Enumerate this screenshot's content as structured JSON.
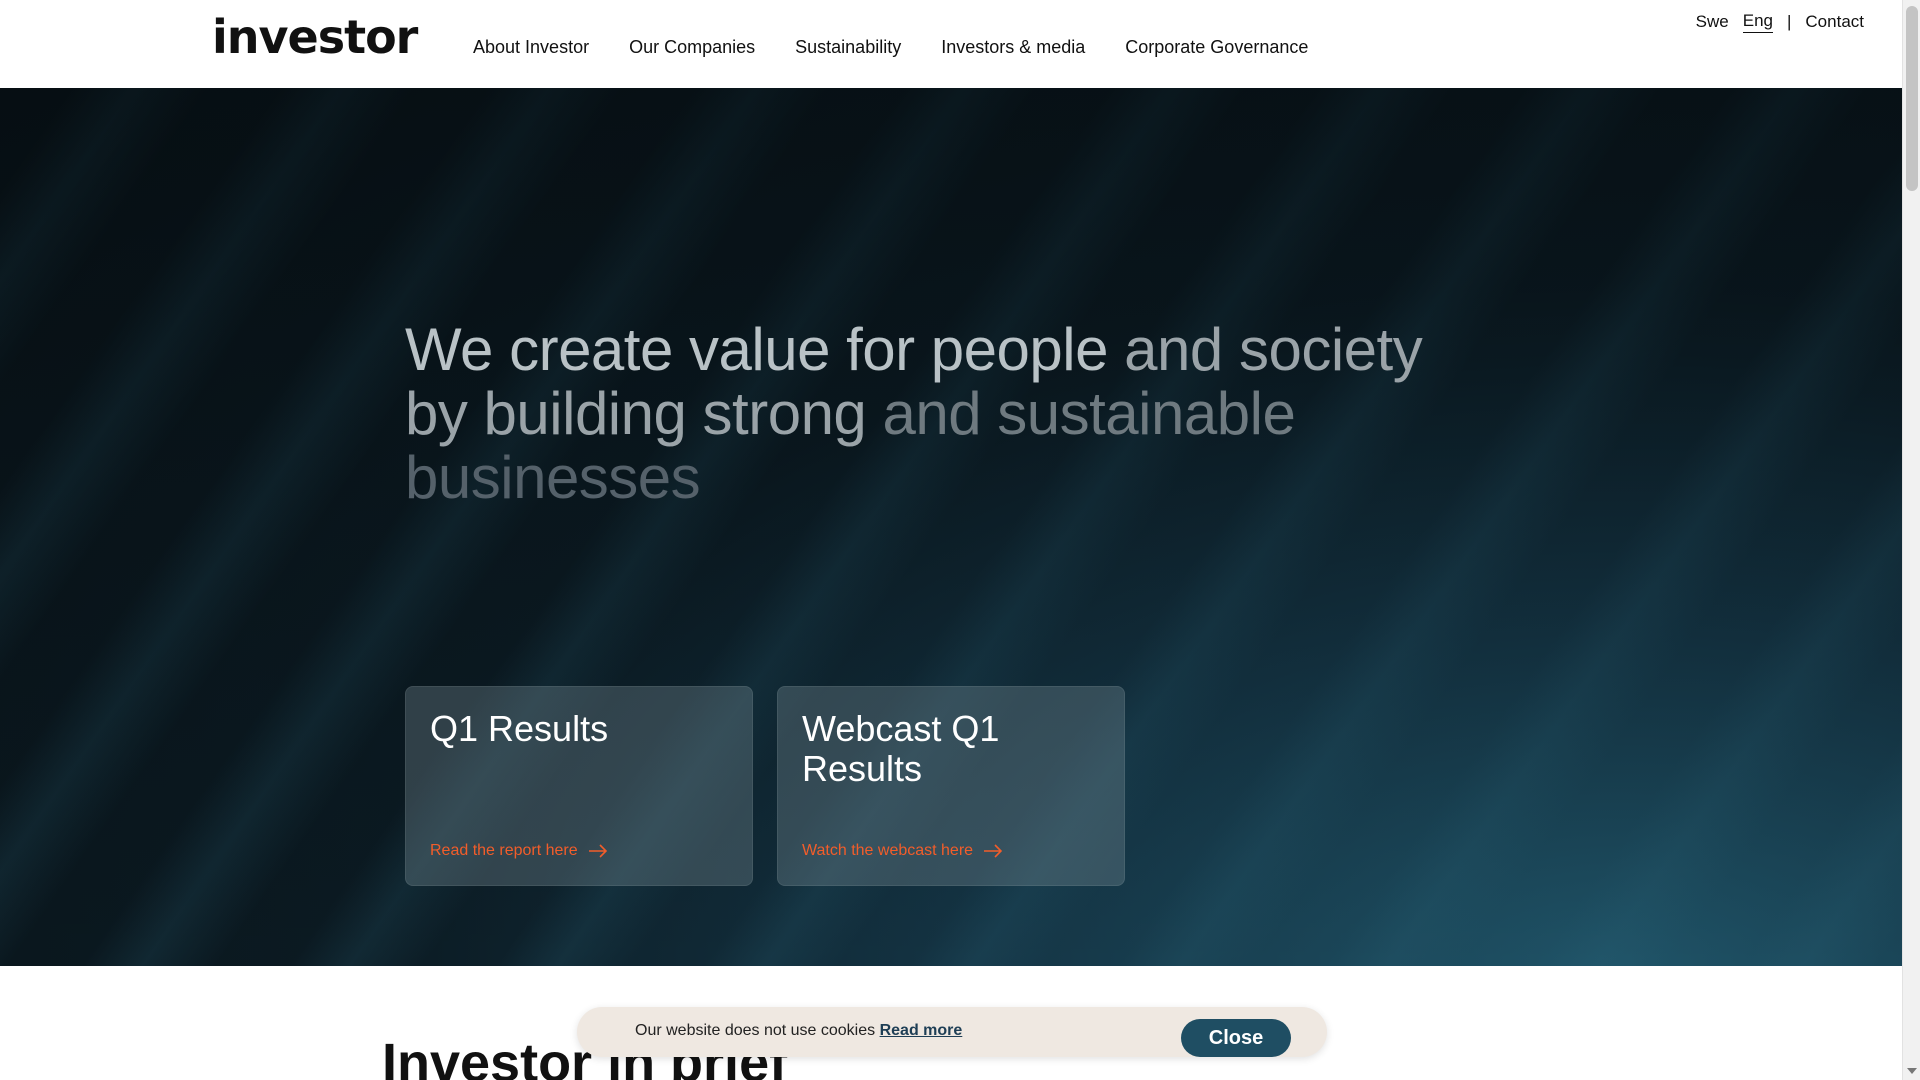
{
  "header": {
    "logo_text": "investor",
    "nav": [
      "About Investor",
      "Our Companies",
      "Sustainability",
      "Investors & media",
      "Corporate Governance"
    ],
    "lang_swe": "Swe",
    "lang_eng": "Eng",
    "separator": "|",
    "contact": "Contact"
  },
  "hero": {
    "line1_a": "We create value for people",
    "line1_b": "and society",
    "line2_a": "by building strong",
    "line2_b": "and sustainable",
    "line3": "businesses",
    "cards": [
      {
        "title": "Q1 Results",
        "link": "Read the report here"
      },
      {
        "title": "Webcast Q1 Results",
        "link": "Watch the webcast here"
      }
    ]
  },
  "section": {
    "brief_title": "Investor in brief"
  },
  "cookie": {
    "text": "Our website does not use cookies",
    "read_more": "Read more",
    "close": "Close"
  },
  "colors": {
    "accent_orange": "#f25d2a",
    "button_teal": "#1f4e63",
    "banner_bg": "#efe8e1"
  }
}
